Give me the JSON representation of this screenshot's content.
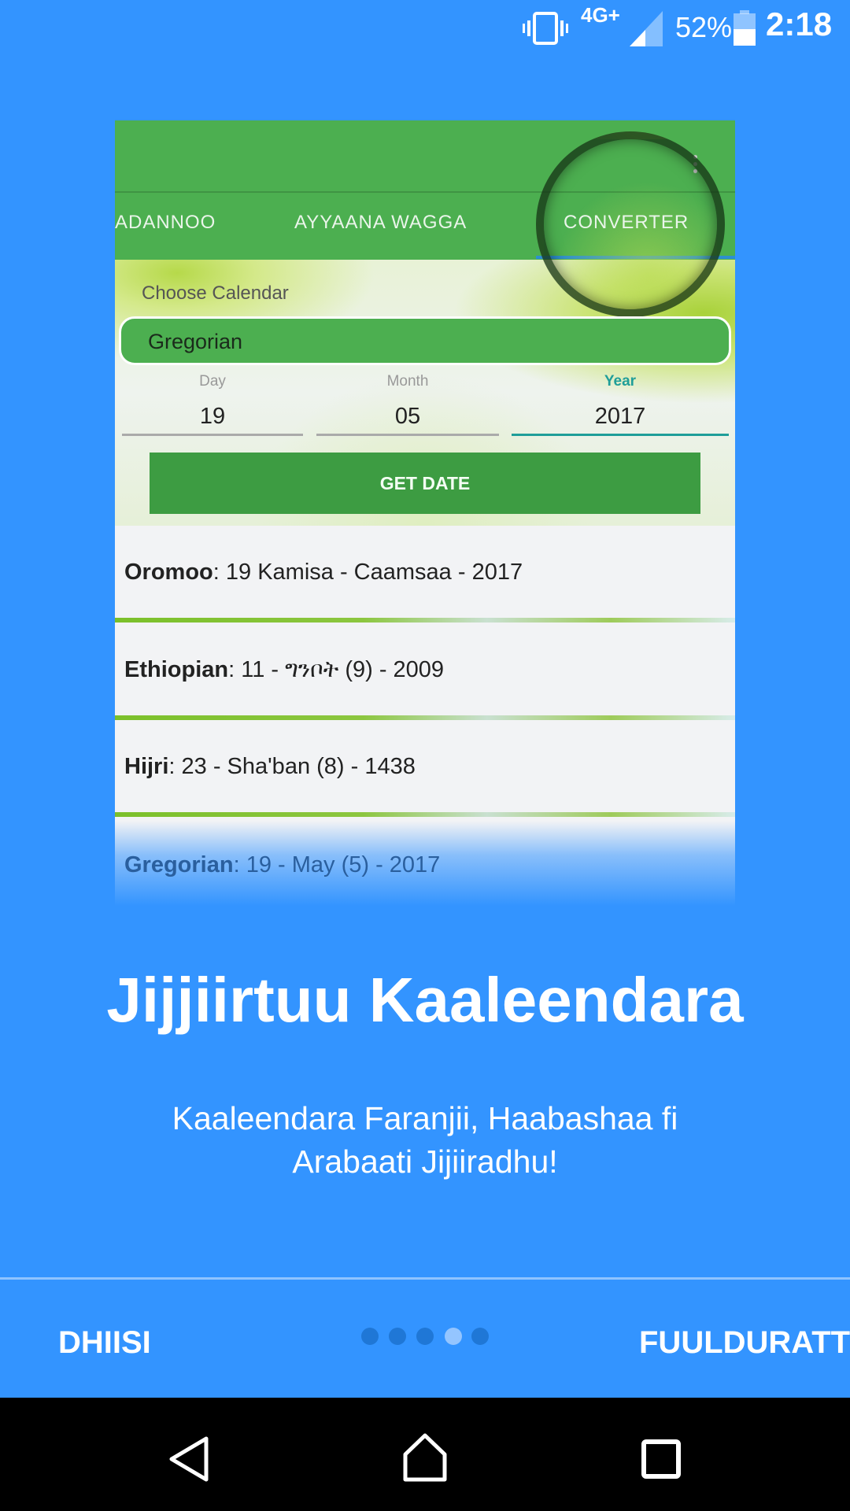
{
  "colors": {
    "background": "#3394ff",
    "app_green": "#4caf50",
    "button_green": "#3d9c42",
    "dot_inactive": "#1f77d6",
    "dot_active": "#94c5ff"
  },
  "status_bar": {
    "network": "4G+",
    "battery": "52%",
    "time": "2:18",
    "icons": [
      "vibrate-icon",
      "signal-icon",
      "battery-icon"
    ]
  },
  "preview": {
    "tabs": [
      "ADANNOO",
      "AYYAANA WAGGA",
      "CONVERTER"
    ],
    "active_tab": "CONVERTER",
    "choose_label": "Choose Calendar",
    "calendar_value": "Gregorian",
    "fields": [
      {
        "label": "Day",
        "value": "19"
      },
      {
        "label": "Month",
        "value": "05"
      },
      {
        "label": "Year",
        "value": "2017"
      }
    ],
    "button": "GET DATE",
    "results": [
      {
        "name": "Oromoo",
        "value": ": 19 Kamisa - Caamsaa - 2017"
      },
      {
        "name": "Ethiopian",
        "value": ": 11 - ግንቦት (9) - 2009"
      },
      {
        "name": "Hijri",
        "value": ": 23 - Sha'ban  (8) - 1438"
      },
      {
        "name": "Gregorian",
        "value": ": 19 - May  (5) - 2017"
      }
    ]
  },
  "title": "Jijjiirtuu Kaaleendara",
  "subtitle_line1": "Kaaleendara Faranjii, Haabashaa fi",
  "subtitle_line2": "Arabaati Jijiiradhu!",
  "footer": {
    "skip": "DHIISI",
    "next": "FUULDURATTI",
    "page_count": 5,
    "current_page": 4
  }
}
